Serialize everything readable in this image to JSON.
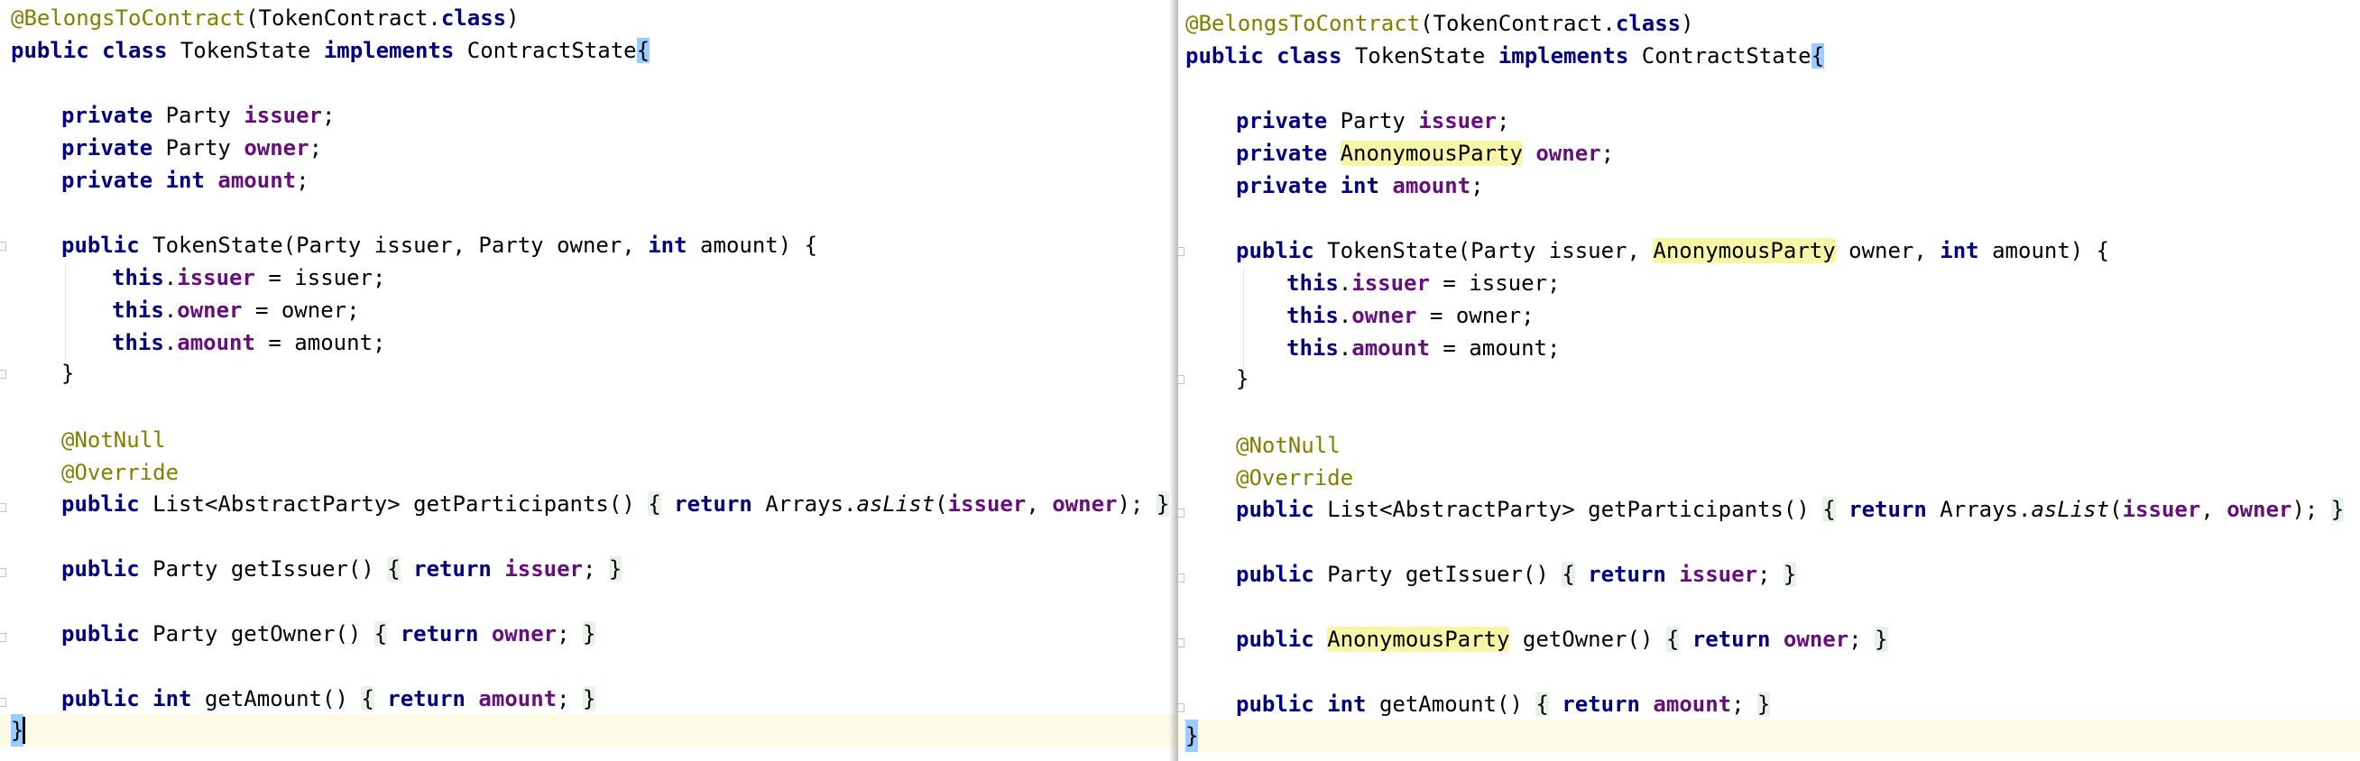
{
  "left": {
    "line1": {
      "annotation": "@BelongsToContract",
      "paren": "(",
      "cls": "TokenContract",
      "dot": ".",
      "kw": "class",
      "close": ")"
    },
    "line2": {
      "public": "public",
      "class": "class",
      "name": "TokenState",
      "implements": "implements",
      "iface": "ContractState",
      "brace": "{"
    },
    "field1": {
      "kw": "private",
      "type": "Party",
      "name": "issuer",
      "semi": ";"
    },
    "field2": {
      "kw": "private",
      "type": "Party",
      "name": "owner",
      "semi": ";"
    },
    "field3": {
      "kw": "private int",
      "name": "amount",
      "semi": ";"
    },
    "ctor": {
      "kw": "public",
      "sig_a": "TokenState(Party issuer, Party owner, ",
      "int": "int",
      "sig_b": " amount) {"
    },
    "assign1": {
      "this": "this",
      "dot": ".",
      "field": "issuer",
      "rest": " = issuer;"
    },
    "assign2": {
      "this": "this",
      "dot": ".",
      "field": "owner",
      "rest": " = owner;"
    },
    "assign3": {
      "this": "this",
      "dot": ".",
      "field": "amount",
      "rest": " = amount;"
    },
    "ctor_close": "}",
    "ann1": "@NotNull",
    "ann2": "@Override",
    "participants": {
      "kw": "public",
      "sig": "List<AbstractParty> getParticipants()",
      "fold_open": "{",
      "ret": "return",
      "arrays": "Arrays.",
      "aslist": "asList",
      "open": "(",
      "issuer": "issuer",
      "comma": ", ",
      "owner": "owner",
      "close": ");",
      "fold_close": "}"
    },
    "get_issuer": {
      "kw": "public",
      "sig": "Party getIssuer()",
      "fold_open": "{",
      "ret": "return",
      "field": "issuer",
      "semi": ";",
      "fold_close": "}"
    },
    "get_owner": {
      "kw": "public",
      "sig": "Party getOwner()",
      "fold_open": "{",
      "ret": "return",
      "field": "owner",
      "semi": ";",
      "fold_close": "}"
    },
    "get_amount": {
      "kw": "public int",
      "sig": "getAmount()",
      "fold_open": "{",
      "ret": "return",
      "field": "amount",
      "semi": ";",
      "fold_close": "}"
    },
    "class_close": "}"
  },
  "right": {
    "line1": {
      "annotation": "@BelongsToContract",
      "paren": "(",
      "cls": "TokenContract",
      "dot": ".",
      "kw": "class",
      "close": ")"
    },
    "line2": {
      "public": "public",
      "class": "class",
      "name": "TokenState",
      "implements": "implements",
      "iface": "ContractState",
      "brace": "{"
    },
    "field1": {
      "kw": "private",
      "type": "Party",
      "name": "issuer",
      "semi": ";"
    },
    "field2": {
      "kw": "private",
      "type": "AnonymousParty",
      "name": "owner",
      "semi": ";"
    },
    "field3": {
      "kw": "private int",
      "name": "amount",
      "semi": ";"
    },
    "ctor": {
      "kw": "public",
      "sig_a": "TokenState(Party issuer, ",
      "anon": "AnonymousParty",
      "sig_mid": " owner, ",
      "int": "int",
      "sig_b": " amount) {"
    },
    "assign1": {
      "this": "this",
      "dot": ".",
      "field": "issuer",
      "rest": " = issuer;"
    },
    "assign2": {
      "this": "this",
      "dot": ".",
      "field": "owner",
      "rest": " = owner;"
    },
    "assign3": {
      "this": "this",
      "dot": ".",
      "field": "amount",
      "rest": " = amount;"
    },
    "ctor_close": "}",
    "ann1": "@NotNull",
    "ann2": "@Override",
    "participants": {
      "kw": "public",
      "sig": "List<AbstractParty> getParticipants()",
      "fold_open": "{",
      "ret": "return",
      "arrays": "Arrays.",
      "aslist": "asList",
      "open": "(",
      "issuer": "issuer",
      "comma": ", ",
      "owner": "owner",
      "close": ");",
      "fold_close": "}"
    },
    "get_issuer": {
      "kw": "public",
      "sig": "Party getIssuer()",
      "fold_open": "{",
      "ret": "return",
      "field": "issuer",
      "semi": ";",
      "fold_close": "}"
    },
    "get_owner": {
      "kw": "public",
      "type": "AnonymousParty",
      "sig": "getOwner()",
      "fold_open": "{",
      "ret": "return",
      "field": "owner",
      "semi": ";",
      "fold_close": "}"
    },
    "get_amount": {
      "kw": "public int",
      "sig": "getAmount()",
      "fold_open": "{",
      "ret": "return",
      "field": "amount",
      "semi": ";",
      "fold_close": "}"
    },
    "class_close": "}"
  }
}
